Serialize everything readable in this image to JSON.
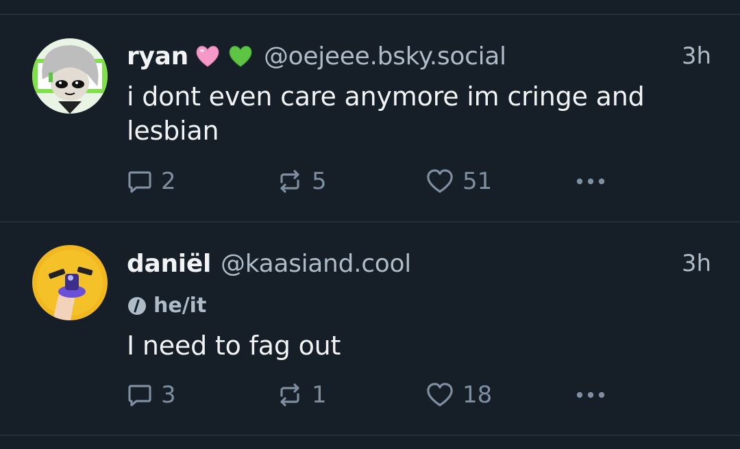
{
  "posts": [
    {
      "author": "ryan",
      "handle": "@oejeee.bsky.social",
      "time": "3h",
      "text": "i dont even care anymore im cringe and lesbian",
      "emojis": [
        "pink-heart",
        "green-heart"
      ],
      "reply_count": "2",
      "repost_count": "5",
      "like_count": "51"
    },
    {
      "author": "daniël",
      "handle": "@kaasiand.cool",
      "time": "3h",
      "pronouns": "he/it",
      "text": "I need to fag out",
      "reply_count": "3",
      "repost_count": "1",
      "like_count": "18"
    }
  ],
  "colors": {
    "background": "#161e27",
    "divider": "#232e3a",
    "muted": "#aebbc9",
    "icon": "#7d8fa1",
    "pink_heart": "#f59ac8",
    "green_heart": "#5cc644"
  }
}
